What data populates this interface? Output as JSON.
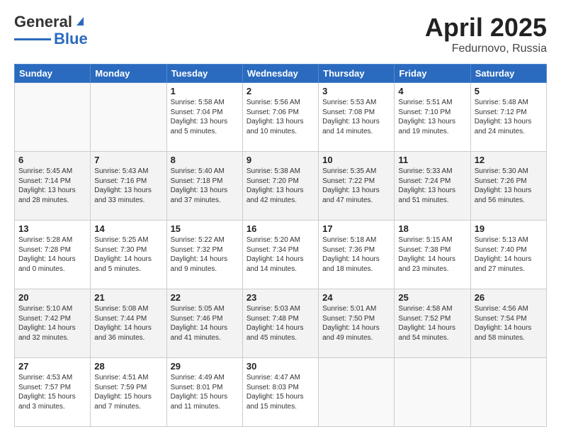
{
  "header": {
    "logo_line1": "General",
    "logo_line2": "Blue",
    "title": "April 2025",
    "location": "Fedurnovo, Russia"
  },
  "weekdays": [
    "Sunday",
    "Monday",
    "Tuesday",
    "Wednesday",
    "Thursday",
    "Friday",
    "Saturday"
  ],
  "weeks": [
    [
      {
        "day": "",
        "info": ""
      },
      {
        "day": "",
        "info": ""
      },
      {
        "day": "1",
        "info": "Sunrise: 5:58 AM\nSunset: 7:04 PM\nDaylight: 13 hours and 5 minutes."
      },
      {
        "day": "2",
        "info": "Sunrise: 5:56 AM\nSunset: 7:06 PM\nDaylight: 13 hours and 10 minutes."
      },
      {
        "day": "3",
        "info": "Sunrise: 5:53 AM\nSunset: 7:08 PM\nDaylight: 13 hours and 14 minutes."
      },
      {
        "day": "4",
        "info": "Sunrise: 5:51 AM\nSunset: 7:10 PM\nDaylight: 13 hours and 19 minutes."
      },
      {
        "day": "5",
        "info": "Sunrise: 5:48 AM\nSunset: 7:12 PM\nDaylight: 13 hours and 24 minutes."
      }
    ],
    [
      {
        "day": "6",
        "info": "Sunrise: 5:45 AM\nSunset: 7:14 PM\nDaylight: 13 hours and 28 minutes."
      },
      {
        "day": "7",
        "info": "Sunrise: 5:43 AM\nSunset: 7:16 PM\nDaylight: 13 hours and 33 minutes."
      },
      {
        "day": "8",
        "info": "Sunrise: 5:40 AM\nSunset: 7:18 PM\nDaylight: 13 hours and 37 minutes."
      },
      {
        "day": "9",
        "info": "Sunrise: 5:38 AM\nSunset: 7:20 PM\nDaylight: 13 hours and 42 minutes."
      },
      {
        "day": "10",
        "info": "Sunrise: 5:35 AM\nSunset: 7:22 PM\nDaylight: 13 hours and 47 minutes."
      },
      {
        "day": "11",
        "info": "Sunrise: 5:33 AM\nSunset: 7:24 PM\nDaylight: 13 hours and 51 minutes."
      },
      {
        "day": "12",
        "info": "Sunrise: 5:30 AM\nSunset: 7:26 PM\nDaylight: 13 hours and 56 minutes."
      }
    ],
    [
      {
        "day": "13",
        "info": "Sunrise: 5:28 AM\nSunset: 7:28 PM\nDaylight: 14 hours and 0 minutes."
      },
      {
        "day": "14",
        "info": "Sunrise: 5:25 AM\nSunset: 7:30 PM\nDaylight: 14 hours and 5 minutes."
      },
      {
        "day": "15",
        "info": "Sunrise: 5:22 AM\nSunset: 7:32 PM\nDaylight: 14 hours and 9 minutes."
      },
      {
        "day": "16",
        "info": "Sunrise: 5:20 AM\nSunset: 7:34 PM\nDaylight: 14 hours and 14 minutes."
      },
      {
        "day": "17",
        "info": "Sunrise: 5:18 AM\nSunset: 7:36 PM\nDaylight: 14 hours and 18 minutes."
      },
      {
        "day": "18",
        "info": "Sunrise: 5:15 AM\nSunset: 7:38 PM\nDaylight: 14 hours and 23 minutes."
      },
      {
        "day": "19",
        "info": "Sunrise: 5:13 AM\nSunset: 7:40 PM\nDaylight: 14 hours and 27 minutes."
      }
    ],
    [
      {
        "day": "20",
        "info": "Sunrise: 5:10 AM\nSunset: 7:42 PM\nDaylight: 14 hours and 32 minutes."
      },
      {
        "day": "21",
        "info": "Sunrise: 5:08 AM\nSunset: 7:44 PM\nDaylight: 14 hours and 36 minutes."
      },
      {
        "day": "22",
        "info": "Sunrise: 5:05 AM\nSunset: 7:46 PM\nDaylight: 14 hours and 41 minutes."
      },
      {
        "day": "23",
        "info": "Sunrise: 5:03 AM\nSunset: 7:48 PM\nDaylight: 14 hours and 45 minutes."
      },
      {
        "day": "24",
        "info": "Sunrise: 5:01 AM\nSunset: 7:50 PM\nDaylight: 14 hours and 49 minutes."
      },
      {
        "day": "25",
        "info": "Sunrise: 4:58 AM\nSunset: 7:52 PM\nDaylight: 14 hours and 54 minutes."
      },
      {
        "day": "26",
        "info": "Sunrise: 4:56 AM\nSunset: 7:54 PM\nDaylight: 14 hours and 58 minutes."
      }
    ],
    [
      {
        "day": "27",
        "info": "Sunrise: 4:53 AM\nSunset: 7:57 PM\nDaylight: 15 hours and 3 minutes."
      },
      {
        "day": "28",
        "info": "Sunrise: 4:51 AM\nSunset: 7:59 PM\nDaylight: 15 hours and 7 minutes."
      },
      {
        "day": "29",
        "info": "Sunrise: 4:49 AM\nSunset: 8:01 PM\nDaylight: 15 hours and 11 minutes."
      },
      {
        "day": "30",
        "info": "Sunrise: 4:47 AM\nSunset: 8:03 PM\nDaylight: 15 hours and 15 minutes."
      },
      {
        "day": "",
        "info": ""
      },
      {
        "day": "",
        "info": ""
      },
      {
        "day": "",
        "info": ""
      }
    ]
  ]
}
